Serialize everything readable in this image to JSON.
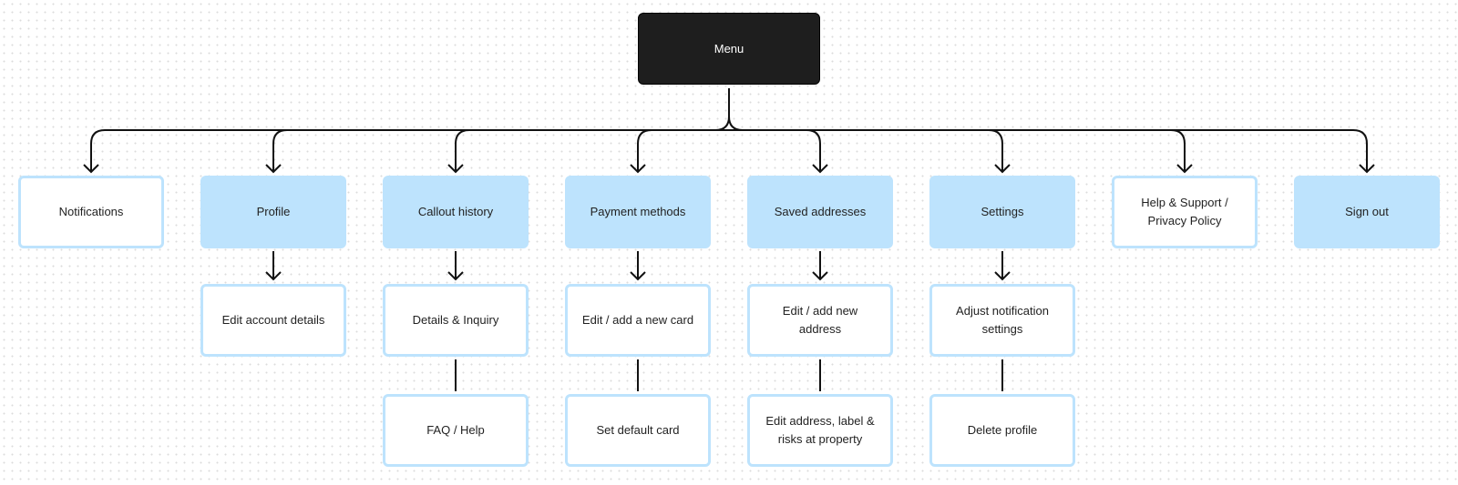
{
  "colors": {
    "root": "#1e1e1e",
    "primary_fill": "#bde3fd",
    "connector": "#111111"
  },
  "root": {
    "label": "Menu"
  },
  "columns": [
    {
      "label": "Notifications",
      "style": "outline",
      "children": []
    },
    {
      "label": "Profile",
      "style": "filled",
      "children": [
        "Edit account details"
      ]
    },
    {
      "label": "Callout history",
      "style": "filled",
      "children": [
        "Details & Inquiry",
        "FAQ / Help"
      ]
    },
    {
      "label": "Payment methods",
      "style": "filled",
      "children": [
        "Edit / add a new card",
        "Set default card"
      ]
    },
    {
      "label": "Saved addresses",
      "style": "filled",
      "children": [
        "Edit / add new address",
        "Edit address, label & risks at property"
      ]
    },
    {
      "label": "Settings",
      "style": "filled",
      "children": [
        "Adjust notification settings",
        "Delete profile"
      ]
    },
    {
      "label": "Help & Support / Privacy Policy",
      "style": "outline",
      "children": []
    },
    {
      "label": "Sign out",
      "style": "filled",
      "children": []
    }
  ]
}
